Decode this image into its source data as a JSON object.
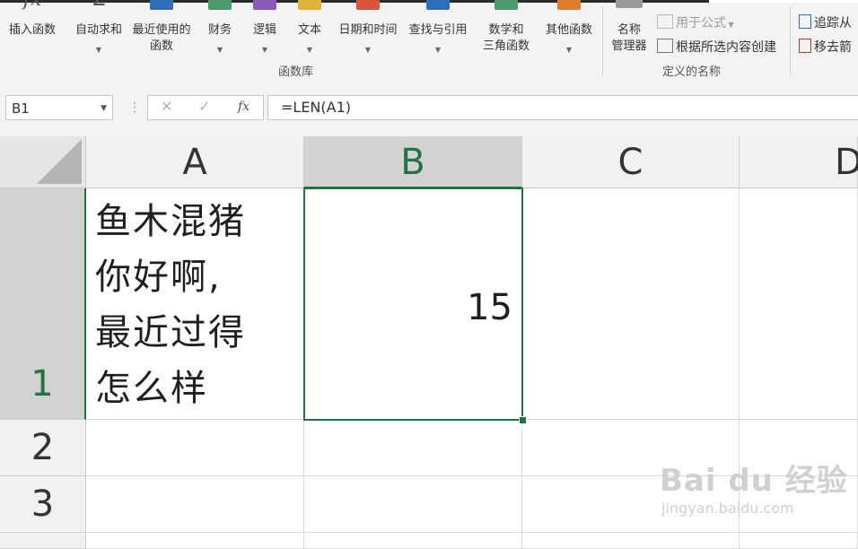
{
  "ribbon": {
    "buttons": [
      {
        "label": "插入函数",
        "icon": "fx-icon",
        "dropdown": false
      },
      {
        "label": "自动求和",
        "icon": "sigma-icon",
        "dropdown": true
      },
      {
        "label": "最近使用的",
        "label2": "函数",
        "icon": "star-book-icon",
        "dropdown": true
      },
      {
        "label": "财务",
        "icon": "finance-book-icon",
        "dropdown": true
      },
      {
        "label": "逻辑",
        "icon": "question-book-icon",
        "dropdown": true
      },
      {
        "label": "文本",
        "icon": "text-book-icon",
        "dropdown": true
      },
      {
        "label": "日期和时间",
        "icon": "calendar-icon",
        "dropdown": true
      },
      {
        "label": "查找与引用",
        "icon": "magnifier-book-icon",
        "dropdown": true
      },
      {
        "label": "数学和",
        "label2": "三角函数",
        "icon": "theta-book-icon",
        "dropdown": true
      },
      {
        "label": "其他函数",
        "icon": "more-book-icon",
        "dropdown": true
      }
    ],
    "group_function_library": "函数库",
    "name_manager": {
      "label": "名称",
      "label2": "管理器"
    },
    "use_in_formula": "用于公式",
    "create_from_selection": "根据所选内容创建",
    "group_defined_names": "定义的名称",
    "trace_precedents": "追踪从",
    "remove_arrows": "移去箭"
  },
  "formula_bar": {
    "name_box": "B1",
    "cancel": "✕",
    "enter": "✓",
    "fx": "fx",
    "formula": "=LEN(A1)"
  },
  "sheet": {
    "columns": [
      "A",
      "B",
      "C",
      "D"
    ],
    "rows": [
      "1",
      "2",
      "3"
    ],
    "active_cell": "B1",
    "a1_lines": [
      "鱼木混猪",
      "你好啊,",
      "最近过得",
      "怎么样"
    ],
    "b1": "15"
  },
  "watermark": {
    "text": "Bai du 经验",
    "url": "jingyan.baidu.com"
  },
  "colors": {
    "accent": "#21733f",
    "header": "#f1f1f1",
    "selected_header": "#d2d2d2"
  }
}
